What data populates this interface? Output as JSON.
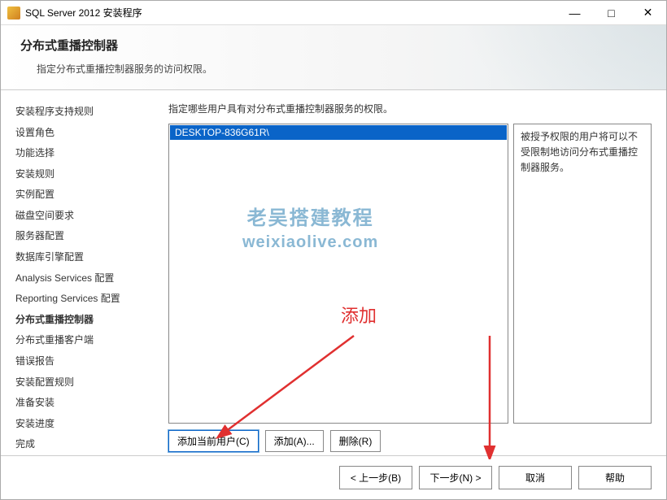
{
  "window": {
    "title": "SQL Server 2012 安装程序"
  },
  "header": {
    "title": "分布式重播控制器",
    "subtitle": "指定分布式重播控制器服务的访问权限。"
  },
  "sidebar": {
    "items": [
      {
        "label": "安装程序支持规则"
      },
      {
        "label": "设置角色"
      },
      {
        "label": "功能选择"
      },
      {
        "label": "安装规则"
      },
      {
        "label": "实例配置"
      },
      {
        "label": "磁盘空间要求"
      },
      {
        "label": "服务器配置"
      },
      {
        "label": "数据库引擎配置"
      },
      {
        "label": "Analysis Services 配置"
      },
      {
        "label": "Reporting Services 配置"
      },
      {
        "label": "分布式重播控制器",
        "active": true
      },
      {
        "label": "分布式重播客户端"
      },
      {
        "label": "错误报告"
      },
      {
        "label": "安装配置规则"
      },
      {
        "label": "准备安装"
      },
      {
        "label": "安装进度"
      },
      {
        "label": "完成"
      }
    ]
  },
  "main": {
    "description": "指定哪些用户具有对分布式重播控制器服务的权限。",
    "selected_user": "DESKTOP-836G61R\\",
    "hint_text": "被授予权限的用户将可以不受限制地访问分布式重播控制器服务。",
    "buttons": {
      "add_current": "添加当前用户(C)",
      "add": "添加(A)...",
      "remove": "删除(R)"
    }
  },
  "footer": {
    "back": "< 上一步(B)",
    "next": "下一步(N) >",
    "cancel": "取消",
    "help": "帮助"
  },
  "watermark": {
    "line1": "老吴搭建教程",
    "line2": "weixiaolive.com"
  },
  "annotation": {
    "label": "添加"
  }
}
